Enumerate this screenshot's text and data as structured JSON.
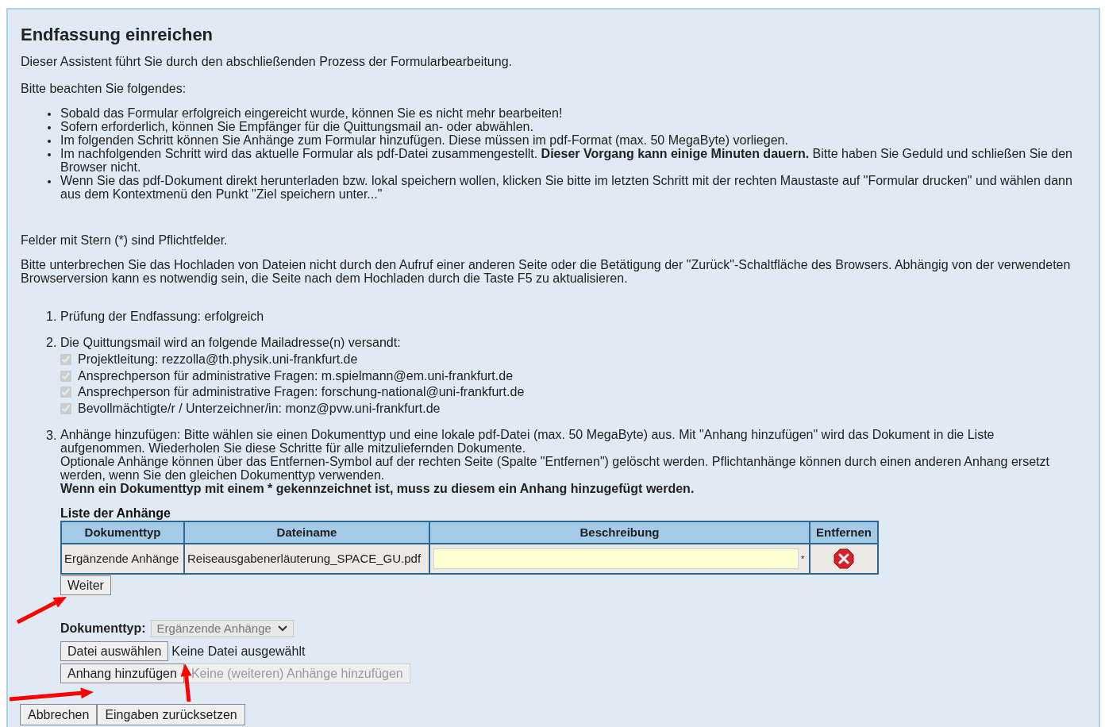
{
  "title": "Endfassung einreichen",
  "intro": "Dieser Assistent führt Sie durch den abschließenden Prozess der Formularbearbeitung.",
  "notice_heading": "Bitte beachten Sie folgendes:",
  "notices": [
    "Sobald das Formular erfolgreich eingereicht wurde, können Sie es nicht mehr bearbeiten!",
    "Sofern erforderlich, können Sie Empfänger für die Quittungsmail an- oder abwählen.",
    "Im folgenden Schritt können Sie Anhänge zum Formular hinzufügen. Diese müssen im pdf-Format (max. 50 MegaByte) vorliegen.",
    "Im nachfolgenden Schritt wird das aktuelle Formular als pdf-Datei zusammengestellt. **Dieser Vorgang kann einige Minuten dauern.** Bitte haben Sie Geduld und schließen Sie den Browser nicht.",
    "Wenn Sie das pdf-Dokument direkt herunterladen bzw. lokal speichern wollen, klicken Sie bitte im letzten Schritt mit der rechten Maustaste auf \"Formular drucken\" und wählen dann aus dem Kontextmenü den Punkt \"Ziel speichern unter...\""
  ],
  "required_note": "Felder mit Stern (*) sind Pflichtfelder.",
  "upload_note": "Bitte unterbrechen Sie das Hochladen von Dateien nicht durch den Aufruf einer anderen Seite oder die Betätigung der \"Zurück\"-Schaltfläche des Browsers. Abhängig von der verwendeten Browserversion kann es notwendig sein, die Seite nach dem Hochladen durch die Taste F5 zu aktualisieren.",
  "steps": [
    {
      "kind": "text",
      "number": "1.",
      "text": "Prüfung der Endfassung: erfolgreich"
    },
    {
      "kind": "recipients",
      "number": "2.",
      "text": "Die Quittungsmail wird an folgende Mailadresse(n) versandt:",
      "recipients": [
        {
          "label": "Projektleitung: rezzolla@th.physik.uni-frankfurt.de",
          "checked": true,
          "disabled": true
        },
        {
          "label": "Ansprechperson für administrative Fragen: m.spielmann@em.uni-frankfurt.de",
          "checked": true,
          "disabled": true
        },
        {
          "label": "Ansprechperson für administrative Fragen: forschung-national@uni-frankfurt.de",
          "checked": true,
          "disabled": true
        },
        {
          "label": "Bevollmächtigte/r / Unterzeichner/in: monz@pvw.uni-frankfurt.de",
          "checked": true,
          "disabled": true
        }
      ]
    },
    {
      "kind": "attachments",
      "number": "3.",
      "paragraphs": [
        "Anhänge hinzufügen: Bitte wählen sie einen Dokumenttyp und eine lokale pdf-Datei (max. 50 MegaByte) aus. Mit \"Anhang hinzufügen\" wird das Dokument in die Liste aufgenommen. Wiederholen Sie diese Schritte für alle mitzuliefernden Dokumente.",
        "Optionale Anhänge können über das Entfernen-Symbol auf der rechten Seite (Spalte \"Entfernen\") gelöscht werden. Pflichtanhänge können durch einen anderen Anhang ersetzt werden, wenn Sie den gleichen Dokumenttyp verwenden."
      ],
      "emphasis": "Wenn ein Dokumenttyp mit einem * gekennzeichnet ist, muss zu diesem ein Anhang hinzugefügt werden.",
      "table": {
        "caption": "Liste der Anhänge",
        "columns": [
          "Dokumenttyp",
          "Dateiname",
          "Beschreibung",
          "Entfernen"
        ],
        "rows": [
          {
            "document_type": "Ergänzende Anhänge",
            "file_name": "Reiseausgabenerläuterung_SPACE_GU.pdf",
            "required_mark": "*"
          }
        ]
      },
      "next_button": "Weiter",
      "document_type": {
        "label": "Dokumenttyp:",
        "value": "Ergänzende Anhänge",
        "disabled": true
      },
      "file_button": "Datei auswählen",
      "file_status": "Keine Datei ausgewählt",
      "buttons": [
        {
          "label": "Anhang hinzufügen",
          "disabled": false
        },
        {
          "label": "Keine (weiteren) Anhänge hinzufügen",
          "disabled": true
        }
      ]
    }
  ],
  "footer_buttons": [
    "Abbrechen",
    "Eingaben zurücksetzen"
  ]
}
